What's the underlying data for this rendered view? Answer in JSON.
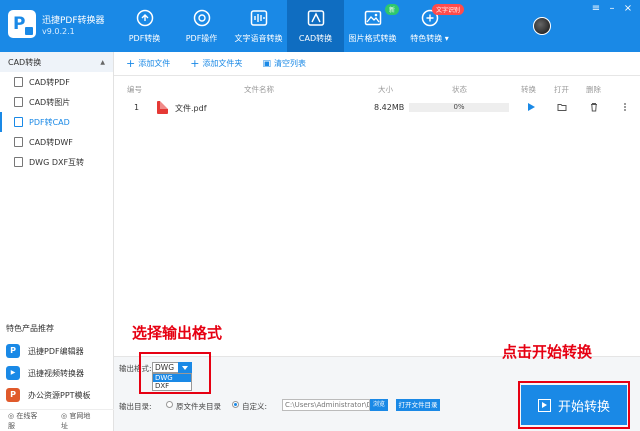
{
  "app": {
    "name": "迅捷PDF转换器",
    "version": "v9.0.2.1"
  },
  "nav": [
    {
      "label": "PDF转换",
      "icon": "pdf-convert-icon"
    },
    {
      "label": "PDF操作",
      "icon": "pdf-operate-icon"
    },
    {
      "label": "文字语音转换",
      "icon": "voice-text-icon"
    },
    {
      "label": "CAD转换",
      "icon": "cad-convert-icon"
    },
    {
      "label": "图片格式转换",
      "icon": "image-convert-icon",
      "badge": "新"
    },
    {
      "label": "特色转换 ▾",
      "icon": "special-convert-icon",
      "badge": "文字识别"
    }
  ],
  "sidebar": {
    "header": "CAD转换",
    "collapse": "▲",
    "items": [
      "CAD转PDF",
      "CAD转图片",
      "PDF转CAD",
      "CAD转DWF",
      "DWG DXF互转"
    ],
    "promo_title": "特色产品推荐",
    "promo": [
      {
        "label": "迅捷PDF编辑器",
        "color": "#1a89e6",
        "glyph": "P"
      },
      {
        "label": "迅捷视频转换器",
        "color": "#1a89e6",
        "glyph": "▶"
      },
      {
        "label": "办公资源PPT模板",
        "color": "#e05a2b",
        "glyph": "P"
      }
    ],
    "footer": [
      "在线客服",
      "官网地址"
    ]
  },
  "toolbar": {
    "add_file": "添加文件",
    "add_folder": "添加文件夹",
    "clear_list": "清空列表"
  },
  "table": {
    "headers": [
      "编号",
      "文件名称",
      "大小",
      "状态",
      "转换",
      "打开",
      "删除"
    ],
    "rows": [
      {
        "num": "1",
        "name": "文件.pdf",
        "size": "8.42MB",
        "progress": "0%"
      }
    ]
  },
  "bottom": {
    "format_label": "输出格式:",
    "format_selected": "DWG",
    "format_options": [
      "DWG",
      "DXF"
    ],
    "dir_label": "输出目录:",
    "opt_original": "原文件夹目录",
    "opt_custom": "自定义:",
    "path": "C:\\Users\\Administrator\\De",
    "browse": "浏览",
    "open_folder": "打开文件目录",
    "start": "开始转换"
  },
  "annotations": {
    "format_hint": "选择输出格式",
    "start_hint": "点击开始转换"
  },
  "colors": {
    "primary": "#1a89e6",
    "annotation": "#e60012"
  }
}
